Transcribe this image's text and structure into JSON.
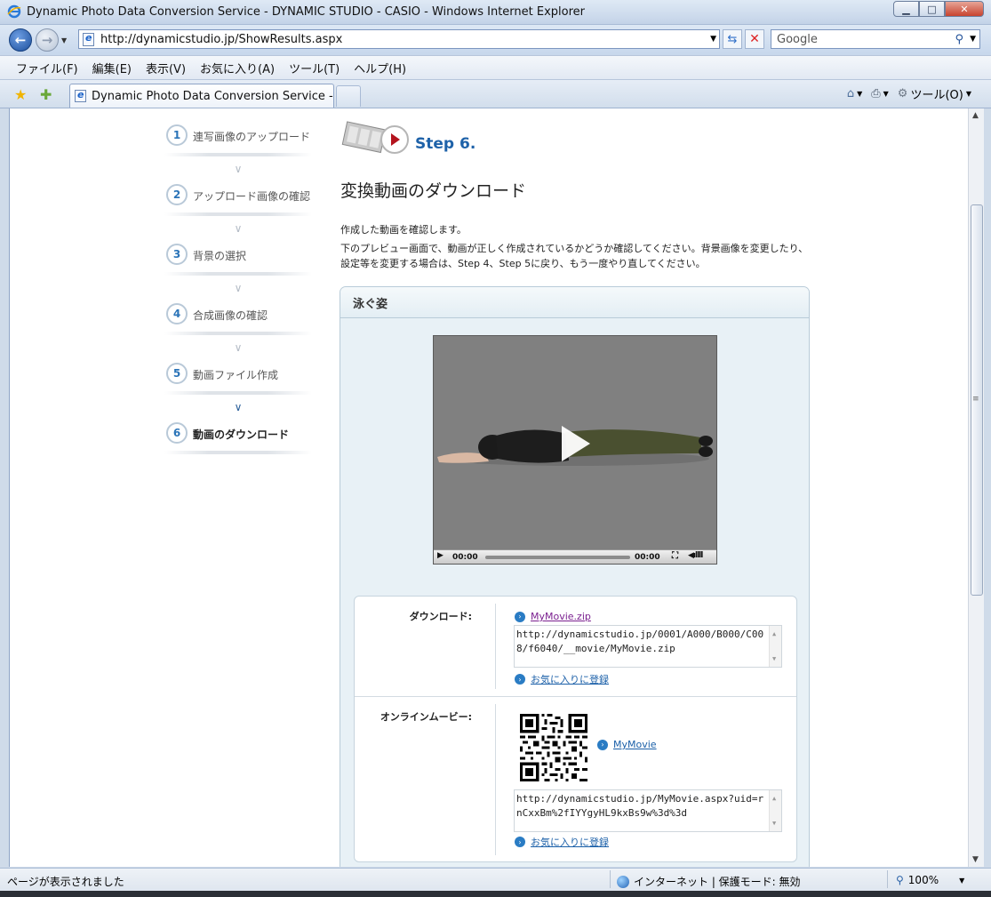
{
  "window": {
    "title": "Dynamic Photo Data Conversion Service - DYNAMIC STUDIO - CASIO - Windows Internet Explorer",
    "buttons": {
      "minimize": "▁",
      "maximize": "□",
      "close": "✕"
    }
  },
  "address": {
    "url": "http://dynamicstudio.jp/ShowResults.aspx",
    "search_placeholder": "Google"
  },
  "menu": [
    "ファイル(F)",
    "編集(E)",
    "表示(V)",
    "お気に入り(A)",
    "ツール(T)",
    "ヘルプ(H)"
  ],
  "tab": {
    "title": "Dynamic Photo Data Conversion Service - D...",
    "tools_label": "ツール(O)"
  },
  "steps": [
    {
      "num": "1",
      "label": "連写画像のアップロード"
    },
    {
      "num": "2",
      "label": "アップロード画像の確認"
    },
    {
      "num": "3",
      "label": "背景の選択"
    },
    {
      "num": "4",
      "label": "合成画像の確認"
    },
    {
      "num": "5",
      "label": "動画ファイル作成"
    },
    {
      "num": "6",
      "label": "動画のダウンロード",
      "active": true
    }
  ],
  "main": {
    "step_title": "Step 6.",
    "heading": "変換動画のダウンロード",
    "intro_line1": "作成した動画を確認します。",
    "intro_line2": "下のプレビュー画面で、動画が正しく作成されているかどうか確認してください。背景画像を変更したり、",
    "intro_line3": "設定等を変更する場合は、Step 4、Step 5に戻り、もう一度やり直してください。"
  },
  "panel": {
    "title": "泳ぐ姿",
    "player": {
      "time_current": "00:00",
      "time_total": "00:00",
      "progress": 0
    }
  },
  "download": {
    "label": "ダウンロード:",
    "link": "MyMovie.zip",
    "url": "http://dynamicstudio.jp/0001/A000/B000/C008/f6040/__movie/MyMovie.zip",
    "favorite": "お気に入りに登録"
  },
  "online": {
    "label": "オンラインムービー:",
    "link": "MyMovie",
    "url": "http://dynamicstudio.jp/MyMovie.aspx?uid=rnCxxBm%2fIYYgyHL9kxBs9w%3d%3d",
    "favorite": "お気に入りに登録"
  },
  "status": {
    "text": "ページが表示されました",
    "zone": "インターネット | 保護モード: 無効",
    "zoom": "100%"
  },
  "colors": {
    "accent": "#1e62a9",
    "panel_bg": "#e8f1f6",
    "link": "#1a5fa8",
    "visited": "#7a1f8f"
  }
}
